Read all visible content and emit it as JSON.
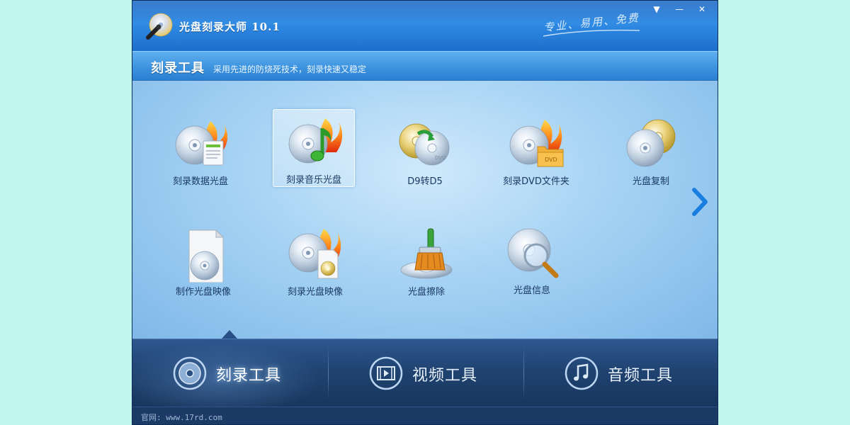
{
  "app": {
    "title": "光盘刻录大师 10.1",
    "slogan": "专业、易用、免费"
  },
  "window_controls": {
    "menu": "▼",
    "minimize": "—",
    "close": "✕"
  },
  "section": {
    "title": "刻录工具",
    "description": "采用先进的防烧死技术，刻录快速又稳定"
  },
  "tools": [
    {
      "label": "刻录数据光盘",
      "icon": "burn-data-disc-icon"
    },
    {
      "label": "刻录音乐光盘",
      "icon": "burn-music-disc-icon",
      "selected": true
    },
    {
      "label": "D9转D5",
      "icon": "d9-to-d5-icon"
    },
    {
      "label": "刻录DVD文件夹",
      "icon": "burn-dvd-folder-icon"
    },
    {
      "label": "光盘复制",
      "icon": "disc-copy-icon"
    },
    {
      "label": "制作光盘映像",
      "icon": "make-disc-image-icon"
    },
    {
      "label": "刻录光盘映像",
      "icon": "burn-disc-image-icon"
    },
    {
      "label": "光盘擦除",
      "icon": "erase-disc-icon"
    },
    {
      "label": "光盘信息",
      "icon": "disc-info-icon"
    }
  ],
  "tabs": [
    {
      "label": "刻录工具",
      "icon": "disc-icon",
      "active": true
    },
    {
      "label": "视频工具",
      "icon": "film-icon"
    },
    {
      "label": "音频工具",
      "icon": "music-note-icon"
    }
  ],
  "footer": {
    "site": "官网: www.17rd.com"
  },
  "colors": {
    "background": "#bff7ef",
    "titlebar": "#2f8be4",
    "tabbar": "#1f426f",
    "accent": "#1a7ee0"
  }
}
